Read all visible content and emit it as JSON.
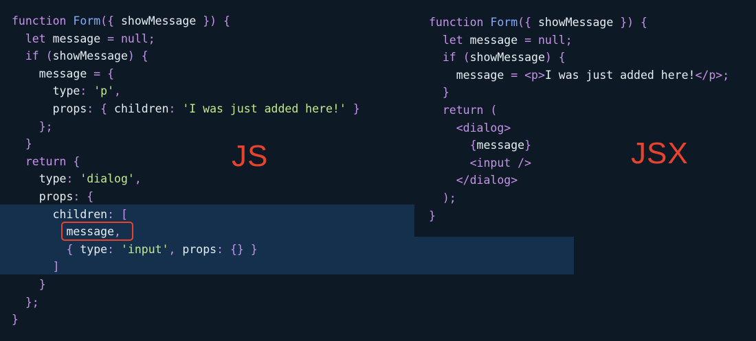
{
  "js_panel": {
    "label": "JS",
    "lines": [
      [
        [
          "k",
          "function"
        ],
        [
          "v",
          " "
        ],
        [
          "f",
          "Form"
        ],
        [
          "p",
          "({"
        ],
        [
          "v",
          " showMessage "
        ],
        [
          "p",
          "})"
        ],
        [
          "v",
          " "
        ],
        [
          "p",
          "{"
        ]
      ],
      [
        [
          "v",
          "  "
        ],
        [
          "k",
          "let"
        ],
        [
          "v",
          " message "
        ],
        [
          "p",
          "="
        ],
        [
          "v",
          " "
        ],
        [
          "k",
          "null"
        ],
        [
          "p",
          ";"
        ]
      ],
      [
        [
          "v",
          "  "
        ],
        [
          "k",
          "if"
        ],
        [
          "v",
          " "
        ],
        [
          "p",
          "("
        ],
        [
          "v",
          "showMessage"
        ],
        [
          "p",
          ")"
        ],
        [
          "v",
          " "
        ],
        [
          "p",
          "{"
        ]
      ],
      [
        [
          "v",
          "    message "
        ],
        [
          "p",
          "="
        ],
        [
          "v",
          " "
        ],
        [
          "p",
          "{"
        ]
      ],
      [
        [
          "v",
          "      type"
        ],
        [
          "p",
          ":"
        ],
        [
          "v",
          " "
        ],
        [
          "s",
          "'p'"
        ],
        [
          "p",
          ","
        ]
      ],
      [
        [
          "v",
          "      props"
        ],
        [
          "p",
          ":"
        ],
        [
          "v",
          " "
        ],
        [
          "p",
          "{"
        ],
        [
          "v",
          " children"
        ],
        [
          "p",
          ":"
        ],
        [
          "v",
          " "
        ],
        [
          "s",
          "'I was just added here!'"
        ],
        [
          "v",
          " "
        ],
        [
          "p",
          "}"
        ]
      ],
      [
        [
          "v",
          "    "
        ],
        [
          "p",
          "};"
        ]
      ],
      [
        [
          "v",
          "  "
        ],
        [
          "p",
          "}"
        ]
      ],
      [
        [
          "v",
          "  "
        ],
        [
          "k",
          "return"
        ],
        [
          "v",
          " "
        ],
        [
          "p",
          "{"
        ]
      ],
      [
        [
          "v",
          "    type"
        ],
        [
          "p",
          ":"
        ],
        [
          "v",
          " "
        ],
        [
          "s",
          "'dialog'"
        ],
        [
          "p",
          ","
        ]
      ],
      [
        [
          "v",
          "    props"
        ],
        [
          "p",
          ":"
        ],
        [
          "v",
          " "
        ],
        [
          "p",
          "{"
        ]
      ],
      [
        [
          "v",
          "      children"
        ],
        [
          "p",
          ":"
        ],
        [
          "v",
          " "
        ],
        [
          "p",
          "["
        ]
      ],
      [
        [
          "v",
          "        message"
        ],
        [
          "p",
          ","
        ]
      ],
      [
        [
          "v",
          "        "
        ],
        [
          "p",
          "{"
        ],
        [
          "v",
          " type"
        ],
        [
          "p",
          ":"
        ],
        [
          "v",
          " "
        ],
        [
          "s",
          "'input'"
        ],
        [
          "p",
          ","
        ],
        [
          "v",
          " props"
        ],
        [
          "p",
          ":"
        ],
        [
          "v",
          " "
        ],
        [
          "p",
          "{}"
        ],
        [
          "v",
          " "
        ],
        [
          "p",
          "}"
        ]
      ],
      [
        [
          "v",
          "      "
        ],
        [
          "p",
          "]"
        ]
      ],
      [
        [
          "v",
          "    "
        ],
        [
          "p",
          "}"
        ]
      ],
      [
        [
          "v",
          "  "
        ],
        [
          "p",
          "};"
        ]
      ],
      [
        [
          "p",
          "}"
        ]
      ]
    ]
  },
  "jsx_panel": {
    "label": "JSX",
    "lines": [
      [
        [
          "k",
          "function"
        ],
        [
          "v",
          " "
        ],
        [
          "f",
          "Form"
        ],
        [
          "p",
          "({"
        ],
        [
          "v",
          " showMessage "
        ],
        [
          "p",
          "})"
        ],
        [
          "v",
          " "
        ],
        [
          "p",
          "{"
        ]
      ],
      [
        [
          "v",
          "  "
        ],
        [
          "k",
          "let"
        ],
        [
          "v",
          " message "
        ],
        [
          "p",
          "="
        ],
        [
          "v",
          " "
        ],
        [
          "k",
          "null"
        ],
        [
          "p",
          ";"
        ]
      ],
      [
        [
          "v",
          "  "
        ],
        [
          "k",
          "if"
        ],
        [
          "v",
          " "
        ],
        [
          "p",
          "("
        ],
        [
          "v",
          "showMessage"
        ],
        [
          "p",
          ")"
        ],
        [
          "v",
          " "
        ],
        [
          "p",
          "{"
        ]
      ],
      [
        [
          "v",
          "    message "
        ],
        [
          "p",
          "="
        ],
        [
          "v",
          " "
        ],
        [
          "t",
          "<p>"
        ],
        [
          "v",
          "I was just added here!"
        ],
        [
          "t",
          "</p>"
        ],
        [
          "p",
          ";"
        ]
      ],
      [
        [
          "v",
          "  "
        ],
        [
          "p",
          "}"
        ]
      ],
      [
        [
          "v",
          "  "
        ],
        [
          "k",
          "return"
        ],
        [
          "v",
          " "
        ],
        [
          "p",
          "("
        ]
      ],
      [
        [
          "v",
          "    "
        ],
        [
          "t",
          "<dialog>"
        ]
      ],
      [
        [
          "v",
          "      "
        ],
        [
          "p",
          "{"
        ],
        [
          "v",
          "message"
        ],
        [
          "p",
          "}"
        ]
      ],
      [
        [
          "v",
          "      "
        ],
        [
          "t",
          "<input />"
        ]
      ],
      [
        [
          "v",
          "    "
        ],
        [
          "t",
          "</dialog>"
        ]
      ],
      [
        [
          "v",
          "  "
        ],
        [
          "p",
          ");"
        ]
      ],
      [
        [
          "p",
          "}"
        ]
      ]
    ]
  },
  "colors": {
    "background": "#0d1a26",
    "highlight": "#14304d",
    "label_red": "#e8442d",
    "keyword": "#c792ea",
    "function": "#82aaff",
    "string": "#c3e88d",
    "plain": "#e6edf3"
  }
}
